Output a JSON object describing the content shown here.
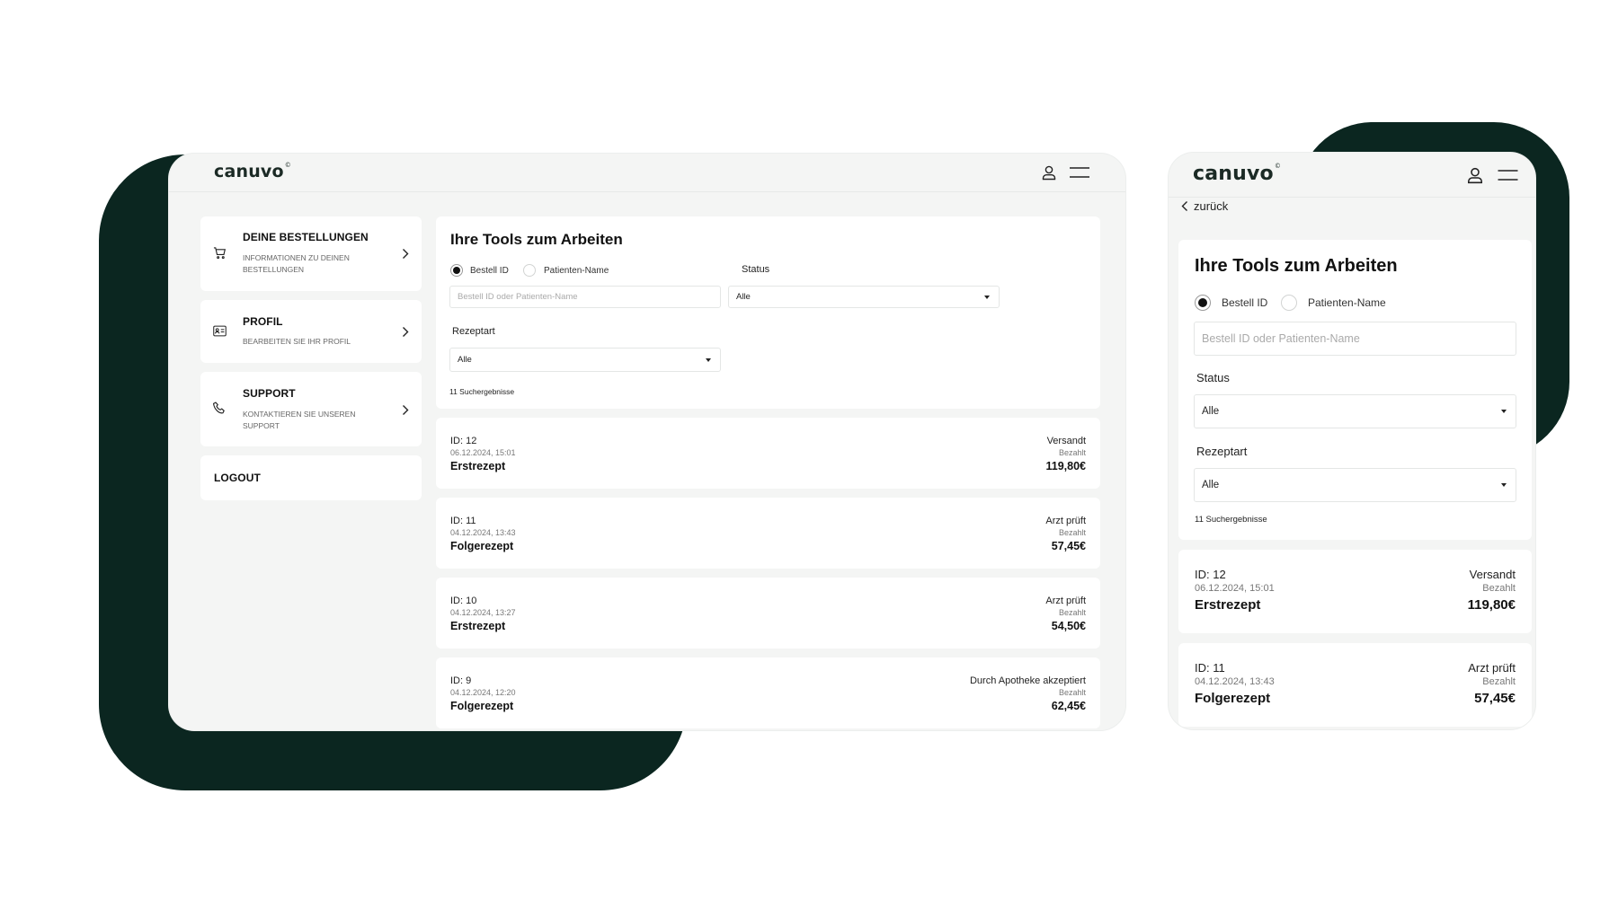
{
  "brand": {
    "logo_text": "canuvo",
    "logo_mark": "©"
  },
  "desktop": {
    "sidebar": [
      {
        "title": "DEINE BESTELLUNGEN",
        "subtitle": "INFORMATIONEN ZU DEINEN BESTELLUNGEN",
        "icon": "cart-icon"
      },
      {
        "title": "PROFIL",
        "subtitle": "BEARBEITEN SIE IHR PROFIL",
        "icon": "id-card-icon"
      },
      {
        "title": "SUPPORT",
        "subtitle": "KONTAKTIEREN SIE UNSEREN SUPPORT",
        "icon": "phone-icon"
      },
      {
        "title": "LOGOUT"
      }
    ],
    "tools": {
      "title": "Ihre Tools zum Arbeiten",
      "radio_order_id": "Bestell ID",
      "radio_patient_name": "Patienten-Name",
      "search_placeholder": "Bestell ID oder Patienten-Name",
      "status_label": "Status",
      "status_value": "Alle",
      "rezeptart_label": "Rezeptart",
      "rezeptart_value": "Alle",
      "results": "11 Suchergebnisse"
    },
    "orders": [
      {
        "id": "ID: 12",
        "date": "06.12.2024, 15:01",
        "type": "Erstrezept",
        "status": "Versandt",
        "payment": "Bezahlt",
        "price": "119,80€"
      },
      {
        "id": "ID: 11",
        "date": "04.12.2024, 13:43",
        "type": "Folgerezept",
        "status": "Arzt prüft",
        "payment": "Bezahlt",
        "price": "57,45€"
      },
      {
        "id": "ID: 10",
        "date": "04.12.2024, 13:27",
        "type": "Erstrezept",
        "status": "Arzt prüft",
        "payment": "Bezahlt",
        "price": "54,50€"
      },
      {
        "id": "ID: 9",
        "date": "04.12.2024, 12:20",
        "type": "Folgerezept",
        "status": "Durch Apotheke akzeptiert",
        "payment": "Bezahlt",
        "price": "62,45€"
      }
    ]
  },
  "mobile": {
    "back_label": "zurück",
    "tools": {
      "title": "Ihre Tools zum Arbeiten",
      "radio_order_id": "Bestell ID",
      "radio_patient_name": "Patienten-Name",
      "search_placeholder": "Bestell ID oder Patienten-Name",
      "status_label": "Status",
      "status_value": "Alle",
      "rezeptart_label": "Rezeptart",
      "rezeptart_value": "Alle",
      "results": "11 Suchergebnisse"
    },
    "orders": [
      {
        "id": "ID: 12",
        "date": "06.12.2024, 15:01",
        "type": "Erstrezept",
        "status": "Versandt",
        "payment": "Bezahlt",
        "price": "119,80€"
      },
      {
        "id": "ID: 11",
        "date": "04.12.2024, 13:43",
        "type": "Folgerezept",
        "status": "Arzt prüft",
        "payment": "Bezahlt",
        "price": "57,45€"
      }
    ]
  },
  "colors": {
    "brand_dark": "#0b2620",
    "panel_bg": "#f4f5f4",
    "card_bg": "#ffffff"
  }
}
